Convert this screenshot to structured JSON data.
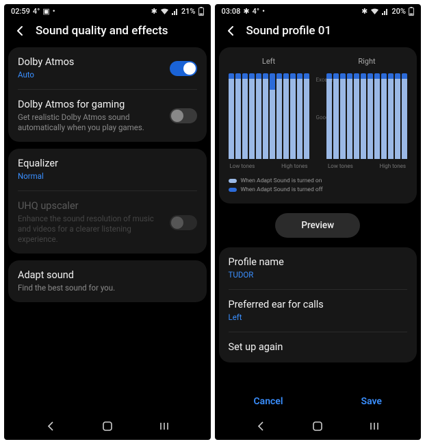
{
  "left": {
    "status": {
      "time": "02:59",
      "temp": "4°",
      "battery": "21%"
    },
    "title": "Sound quality and effects",
    "group1": [
      {
        "label": "Dolby Atmos",
        "sub": "Auto",
        "subBlue": true,
        "toggle": "on"
      },
      {
        "label": "Dolby Atmos for gaming",
        "sub": "Get realistic Dolby Atmos sound automatically when you play games.",
        "toggle": "off"
      }
    ],
    "group2": [
      {
        "label": "Equalizer",
        "sub": "Normal",
        "subBlue": true
      },
      {
        "label": "UHQ upscaler",
        "sub": "Enhance the sound resolution of music and videos for a clearer listening experience.",
        "toggle": "off",
        "disabled": true
      }
    ],
    "group3": [
      {
        "label": "Adapt sound",
        "sub": "Find the best sound for you."
      }
    ]
  },
  "right": {
    "status": {
      "time": "03:08",
      "temp": "4°",
      "battery": "20%"
    },
    "title": "Sound profile 01",
    "chartLeftLabel": "Left",
    "chartRightLabel": "Right",
    "yLabels": {
      "excellent": "Excellent",
      "good": "Good"
    },
    "xLow": "Low tones",
    "xHigh": "High tones",
    "legend": [
      {
        "color": "#9bb9e6",
        "text": "When Adapt Sound is turned on"
      },
      {
        "color": "#2c6bd9",
        "text": "When Adapt Sound is turned off"
      }
    ],
    "previewLabel": "Preview",
    "rows": [
      {
        "label": "Profile name",
        "sub": "TUDOR",
        "subBlue": true
      },
      {
        "label": "Preferred ear for calls",
        "sub": "Left",
        "subBlue": true
      },
      {
        "label": "Set up again"
      }
    ],
    "cancel": "Cancel",
    "save": "Save"
  },
  "chart_data": [
    {
      "type": "bar",
      "title": "Left",
      "xlabel_low": "Low tones",
      "xlabel_high": "High tones",
      "ylabels": [
        "Good",
        "Excellent"
      ],
      "ylim": [
        0,
        100
      ],
      "series": [
        {
          "name": "When Adapt Sound is turned off",
          "values": [
            96,
            96,
            96,
            96,
            96,
            96,
            96,
            96,
            96,
            96,
            96,
            96
          ]
        },
        {
          "name": "When Adapt Sound is turned on",
          "values": [
            90,
            90,
            90,
            90,
            90,
            90,
            78,
            90,
            90,
            90,
            90,
            90
          ]
        }
      ]
    },
    {
      "type": "bar",
      "title": "Right",
      "xlabel_low": "Low tones",
      "xlabel_high": "High tones",
      "ylabels": [
        "Good",
        "Excellent"
      ],
      "ylim": [
        0,
        100
      ],
      "series": [
        {
          "name": "When Adapt Sound is turned off",
          "values": [
            96,
            96,
            96,
            96,
            96,
            96,
            96,
            96,
            96,
            96,
            96,
            96
          ]
        },
        {
          "name": "When Adapt Sound is turned on",
          "values": [
            90,
            90,
            90,
            90,
            90,
            90,
            90,
            90,
            90,
            90,
            90,
            90
          ]
        }
      ]
    }
  ]
}
